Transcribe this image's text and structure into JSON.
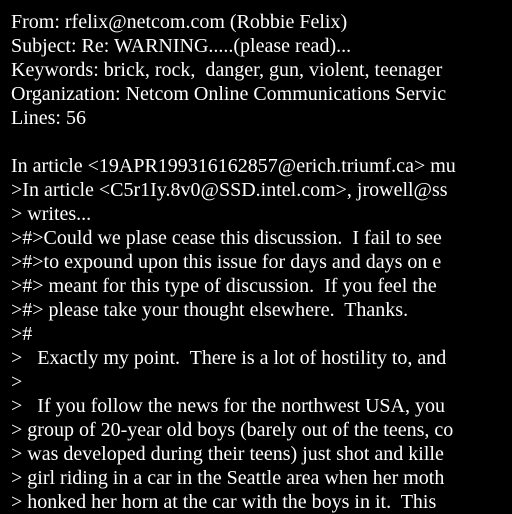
{
  "colors": {
    "background": "#000000",
    "text": "#ffffff"
  },
  "lines": [
    "From: rfelix@netcom.com (Robbie Felix)",
    "Subject: Re: WARNING.....(please read)...",
    "Keywords: brick, rock,  danger, gun, violent, teenager",
    "Organization: Netcom Online Communications Servic",
    "Lines: 56",
    "",
    "In article <19APR199316162857@erich.triumf.ca> mu",
    ">In article <C5r1Iy.8v0@SSD.intel.com>, jrowell@ss",
    "> writes...",
    ">#>Could we plase cease this discussion.  I fail to see",
    ">#>to expound upon this issue for days and days on e",
    ">#> meant for this type of discussion.  If you feel the",
    ">#> please take your thought elsewhere.  Thanks.",
    ">#",
    ">   Exactly my point.  There is a lot of hostility to, and",
    ">",
    ">   If you follow the news for the northwest USA, you",
    "> group of 20-year old boys (barely out of the teens, co",
    "> was developed during their teens) just shot and kille",
    "> girl riding in a car in the Seattle area when her moth",
    "> honked her horn at the car with the boys in it.  This"
  ]
}
